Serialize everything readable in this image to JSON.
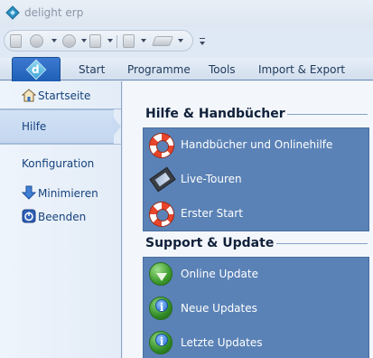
{
  "window": {
    "title": "delight erp"
  },
  "ribbon": {
    "tabs": [
      {
        "label": "Start"
      },
      {
        "label": "Programme"
      },
      {
        "label": "Tools"
      },
      {
        "label": "Import & Export"
      }
    ]
  },
  "nav": {
    "items": [
      {
        "label": "Startseite",
        "icon": "house-icon"
      },
      {
        "label": "Hilfe",
        "selected": true
      },
      {
        "label": "Konfiguration"
      },
      {
        "label": "Minimieren",
        "icon": "arrow-down-icon"
      },
      {
        "label": "Beenden",
        "icon": "power-icon"
      }
    ]
  },
  "groups": [
    {
      "title": "Hilfe & Handbücher",
      "entries": [
        {
          "label": "Handbücher und Onlinehilfe",
          "icon": "lifebuoy-icon"
        },
        {
          "label": "Live-Touren",
          "icon": "film-icon"
        },
        {
          "label": "Erster Start",
          "icon": "lifebuoy-icon"
        }
      ]
    },
    {
      "title": "Support & Update",
      "entries": [
        {
          "label": "Online Update",
          "icon": "globe-download-icon"
        },
        {
          "label": "Neue Updates",
          "icon": "globe-info-icon"
        },
        {
          "label": "Letzte Updates",
          "icon": "globe-info-icon"
        }
      ]
    }
  ],
  "colors": {
    "panel": "#5a82b6",
    "app_tab": "#2b6cc4",
    "nav_text": "#15427c"
  }
}
